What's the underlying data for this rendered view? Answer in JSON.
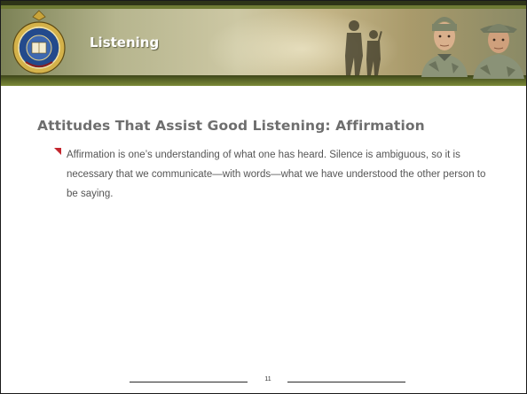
{
  "header": {
    "title": "Listening"
  },
  "content": {
    "heading": "Attitudes That Assist Good Listening: Affirmation",
    "bullet_text": "Affirmation is one’s understanding of what one has heard. Silence is ambiguous, so it is necessary that we communicate—with words—what we have understood the other person to be saying."
  },
  "footer": {
    "page_number": "11"
  },
  "colors": {
    "banner_dark": "#2e3418",
    "banner_olive": "#6e7a34",
    "heading": "#6e6e6e",
    "body_text": "#555555",
    "bullet_accent": "#c4262e"
  },
  "icons": {
    "logo": "army-seal-icon",
    "bullet": "red-triangle-bullet-icon"
  }
}
